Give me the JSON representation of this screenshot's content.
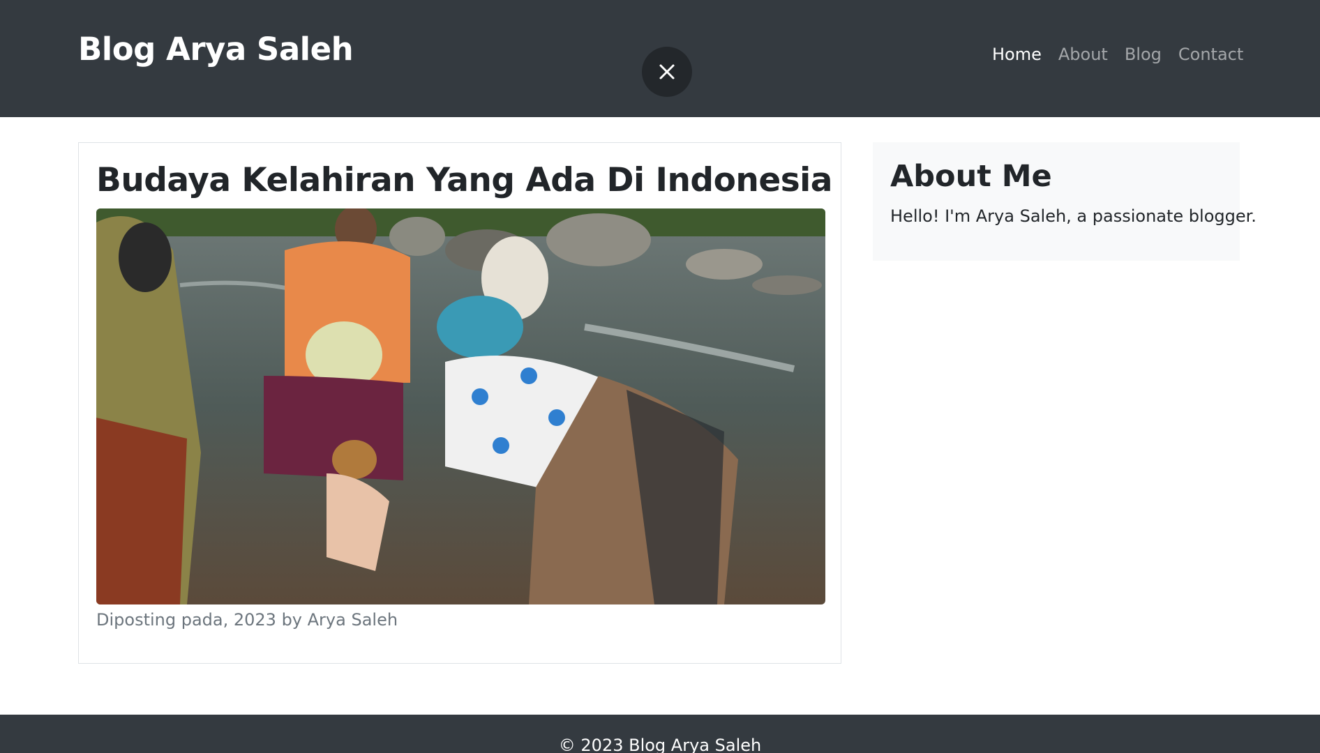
{
  "navbar": {
    "brand": "Blog Arya Saleh",
    "links": [
      {
        "label": "Home",
        "active": true
      },
      {
        "label": "About",
        "active": false
      },
      {
        "label": "Blog",
        "active": false
      },
      {
        "label": "Contact",
        "active": false
      }
    ],
    "close_icon": "close-icon"
  },
  "post": {
    "title": "Budaya Kelahiran Yang Ada Di Indonesia",
    "image_alt": "",
    "meta": "Diposting pada, 2023 by Arya Saleh"
  },
  "sidebar": {
    "about_title": "About Me",
    "about_text": "Hello! I'm Arya Saleh, a passionate blogger."
  },
  "footer": {
    "text": "© 2023 Blog Arya Saleh"
  },
  "colors": {
    "navbar_bg": "#343a40",
    "sidebar_bg": "#f8f9fa",
    "muted_text": "#6c757d"
  }
}
